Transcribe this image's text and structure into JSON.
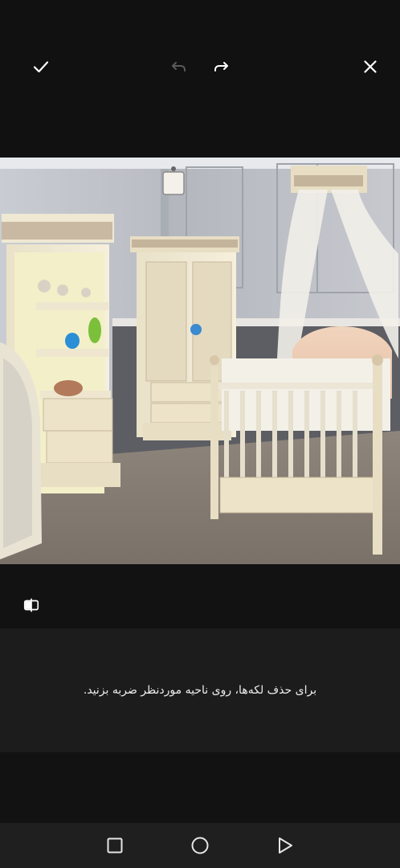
{
  "toolbar": {
    "confirm_icon": "checkmark-icon",
    "undo_icon": "undo-arrow-icon",
    "undo_enabled": false,
    "redo_icon": "redo-arrow-icon",
    "redo_enabled": true,
    "close_icon": "close-icon",
    "icon_color": "#ffffff",
    "disabled_icon_color": "#5a5a5a"
  },
  "image": {
    "subject": "nursery room with cream furniture: bookshelf, wardrobe, canopy crib"
  },
  "compare": {
    "icon": "compare-split-icon"
  },
  "hint": {
    "text": "برای حذف لکه‌ها، روی ناحیه موردنظر ضربه بزنید."
  },
  "navbar": {
    "recents_icon": "square-recents-icon",
    "home_icon": "circle-home-icon",
    "back_icon": "triangle-back-icon"
  }
}
